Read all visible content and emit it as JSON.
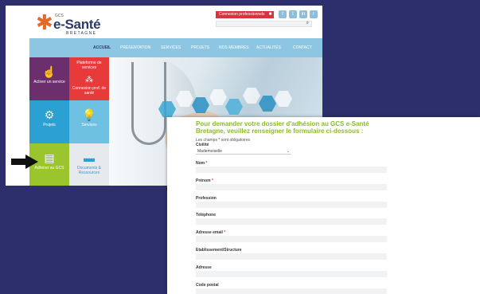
{
  "site": {
    "logo": {
      "gcs": "GCS",
      "name": "e-Santé",
      "sub": "BRETAGNE"
    },
    "top_button": "Connexion professionnels",
    "nav": [
      "ACCUEIL",
      "PRÉSENTATION",
      "SERVICES",
      "PROJETS",
      "NOS MEMBRES",
      "ACTUALITÉS",
      "CONTACT"
    ],
    "tiles": [
      {
        "label": "Activer un service",
        "icon": "hand-pointer-icon"
      },
      {
        "label": "Plateforme de services",
        "label2": "Connexion prof. de santé",
        "icon": "network-icon"
      },
      {
        "label": "Projets",
        "icon": "gears-icon"
      },
      {
        "label": "Services",
        "icon": "lightbulb-icon"
      },
      {
        "label": "Adhérer au GCS",
        "icon": "document-icon"
      },
      {
        "label": "Documents & Ressources",
        "icon": "folder-icon"
      }
    ]
  },
  "form": {
    "title_line1": "Pour demander votre dossier d'adhésion au GCS e-Santé",
    "title_line2": "Bretagne, veuillez renseigner le formulaire ci-dessous :",
    "required_note": "Les champs * sont obligatoires",
    "civility": {
      "label": "Civilité",
      "value": "Mademoiselle"
    },
    "fields": [
      {
        "label": "Nom",
        "required": true
      },
      {
        "label": "Prénom",
        "required": true
      },
      {
        "label": "Profession",
        "required": false
      },
      {
        "label": "Téléphone",
        "required": false
      },
      {
        "label": "Adresse email",
        "required": true
      },
      {
        "label": "Etablissement/Structure",
        "required": false
      },
      {
        "label": "Adresse",
        "required": false
      },
      {
        "label": "Code postal",
        "required": false
      }
    ]
  }
}
